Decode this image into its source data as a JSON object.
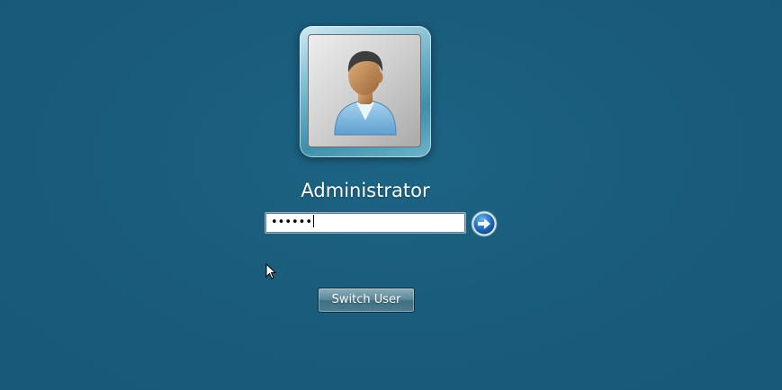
{
  "login": {
    "username": "Administrator",
    "password_value": "••••••"
  },
  "buttons": {
    "switch_user_label": "Switch User"
  },
  "icons": {
    "avatar": "user-avatar-icon",
    "submit": "arrow-right-icon",
    "cursor": "mouse-pointer-icon"
  },
  "colors": {
    "background": "#1a5c7c",
    "accent": "#1d6fb8",
    "text": "#ffffff"
  }
}
